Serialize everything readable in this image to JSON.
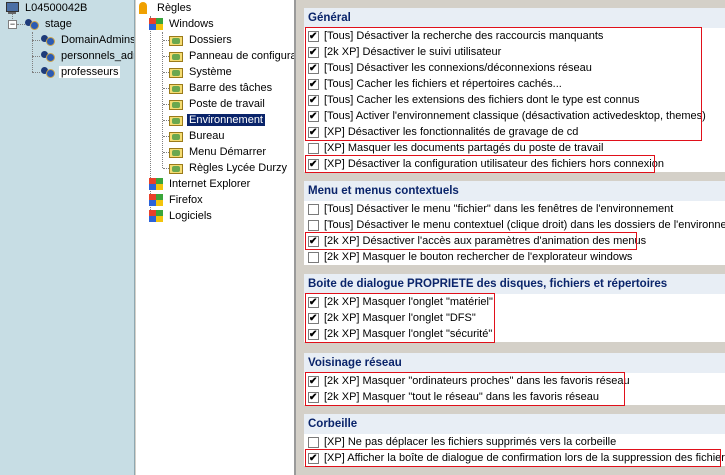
{
  "left_tree": {
    "root": "L04500042B",
    "stage": "stage",
    "groups": [
      "DomainAdmins",
      "personnels_adm",
      "professeurs"
    ]
  },
  "mid_tree": {
    "root": "Règles",
    "windows": "Windows",
    "children": [
      "Dossiers",
      "Panneau de configura",
      "Système",
      "Barre des tâches",
      "Poste de travail",
      "Environnement",
      "Bureau",
      "Menu Démarrer",
      "Règles Lycée Durzy"
    ],
    "others": [
      "Internet Explorer",
      "Firefox",
      "Logiciels"
    ]
  },
  "sections": [
    {
      "title": "Général",
      "options": [
        {
          "label": "[Tous] Désactiver la recherche des raccourcis manquants",
          "checked": true
        },
        {
          "label": "[2k XP] Désactiver le suivi utilisateur",
          "checked": true
        },
        {
          "label": "[Tous] Désactiver les connexions/déconnexions réseau",
          "checked": true
        },
        {
          "label": "[Tous] Cacher les fichiers et répertoires cachés...",
          "checked": true
        },
        {
          "label": "[Tous] Cacher les extensions des fichiers dont le type est connus",
          "checked": true
        },
        {
          "label": "[Tous] Activer l'environnement classique (désactivation activedesktop, themes)",
          "checked": true
        },
        {
          "label": "[XP] Désactiver les fonctionnalités de gravage de cd",
          "checked": true
        },
        {
          "label": "[XP] Masquer les documents partagés du poste de travail",
          "checked": false
        },
        {
          "label": "[XP] Désactiver la configuration utilisateur des fichiers hors connexion",
          "checked": true
        }
      ]
    },
    {
      "title": "Menu et menus contextuels",
      "options": [
        {
          "label": "[Tous] Désactiver le menu \"fichier\" dans les fenêtres de l'environnement",
          "checked": false
        },
        {
          "label": "[Tous] Désactiver le menu contextuel (clique droit) dans les dossiers de l'environneme",
          "checked": false
        },
        {
          "label": "[2k XP] Désactiver l'accès aux paramètres d'animation des menus",
          "checked": true
        },
        {
          "label": "[2k XP] Masquer le bouton rechercher de l'explorateur windows",
          "checked": false
        }
      ]
    },
    {
      "title": "Boite de dialogue PROPRIETE des disques, fichiers et répertoires",
      "options": [
        {
          "label": "[2k XP] Masquer l'onglet \"matériel\"",
          "checked": true
        },
        {
          "label": "[2k XP] Masquer l'onglet \"DFS\"",
          "checked": true
        },
        {
          "label": "[2k XP] Masquer l'onglet \"sécurité\"",
          "checked": true
        }
      ]
    },
    {
      "title": "Voisinage réseau",
      "options": [
        {
          "label": "[2k XP] Masquer \"ordinateurs proches\" dans les favoris réseau",
          "checked": true
        },
        {
          "label": "[2k XP] Masquer \"tout le réseau\" dans les favoris réseau",
          "checked": true
        }
      ]
    },
    {
      "title": "Corbeille",
      "options": [
        {
          "label": "[XP] Ne pas déplacer les fichiers supprimés vers la corbeille",
          "checked": false
        },
        {
          "label": "[XP] Afficher la boîte de dialogue de confirmation lors de la suppression des fichiers",
          "checked": true
        }
      ]
    }
  ]
}
